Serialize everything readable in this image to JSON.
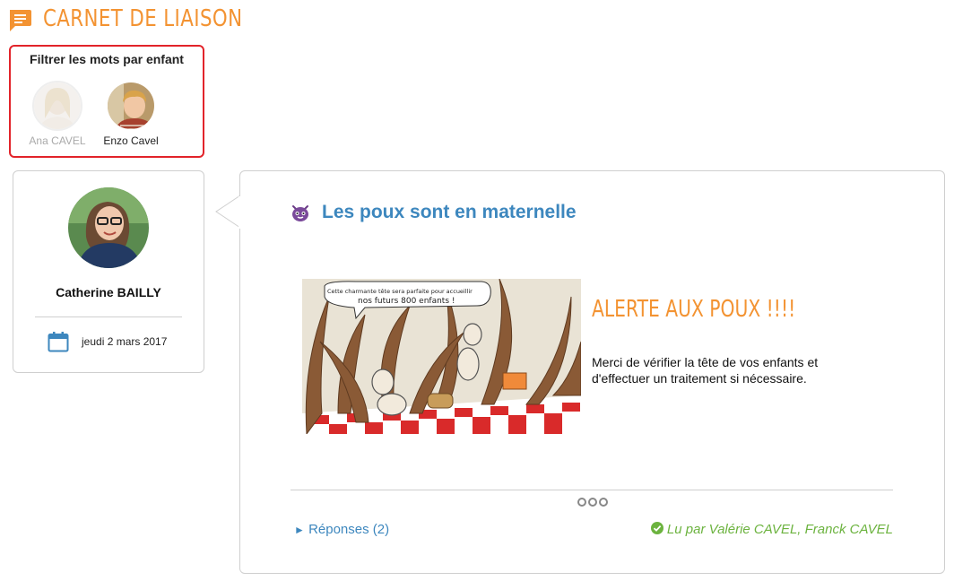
{
  "header": {
    "title": "CARNET DE LIAISON",
    "icon": "message-icon",
    "accent": "#f39332"
  },
  "filter": {
    "title": "Filtrer les mots par enfant",
    "children": [
      {
        "name": "Ana CAVEL",
        "selected": false
      },
      {
        "name": "Enzo Cavel",
        "selected": true
      }
    ]
  },
  "author": {
    "name": "Catherine BAILLY",
    "date": "jeudi 2 mars 2017"
  },
  "post": {
    "title": "Les poux sont en maternelle",
    "image_caption_line1": "Cette charmante tête sera parfaite pour accueillir",
    "image_caption_line2": "nos futurs 800 enfants !",
    "alert_title": "ALERTE AUX POUX !!!!",
    "alert_text": "Merci de vérifier la tête de vos enfants et d'effectuer un traitement si nécessaire.",
    "replies_label": "Réponses (2)",
    "read_by": "Lu par Valérie CAVEL, Franck CAVEL"
  },
  "colors": {
    "accent": "#f39332",
    "link": "#3d87be",
    "read": "#6cb33f",
    "filter_border": "#e2232a"
  }
}
